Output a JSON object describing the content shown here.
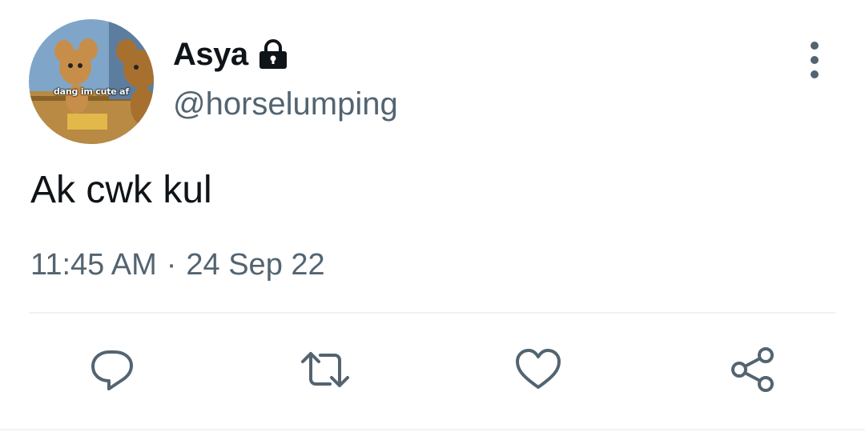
{
  "tweet": {
    "author": {
      "display_name": "Asya",
      "handle": "@horselumping",
      "protected": true,
      "avatar_caption": "dang im cute af"
    },
    "text": "Ak cwk kul",
    "time": "11:45 AM",
    "separator": "·",
    "date": "24 Sep 22"
  },
  "actions": [
    "reply-icon",
    "retweet-icon",
    "like-icon",
    "share-icon"
  ],
  "colors": {
    "text_primary": "#0f1419",
    "text_secondary": "#536471",
    "divider": "#eff3f4"
  }
}
